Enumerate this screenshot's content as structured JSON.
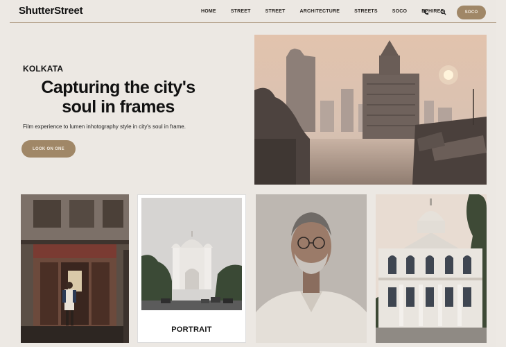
{
  "header": {
    "logo": "ShutterStreet",
    "nav": [
      "HOME",
      "STREET",
      "STREET",
      "ARCHITECTURE",
      "STREETS",
      "SOCO",
      "EPHIRES"
    ],
    "cta_label": "SOCO"
  },
  "hero": {
    "eyebrow": "KOLKATA",
    "headline": "Capturing the city's soul in frames",
    "subtitle": "Film experience to lumen inhotography style in city's soul in frame.",
    "button_label": "LOOK ON ONE"
  },
  "gallery": {
    "portrait_caption": "PORTRAIT"
  },
  "colors": {
    "accent": "#a08767",
    "background": "#ece8e3"
  }
}
